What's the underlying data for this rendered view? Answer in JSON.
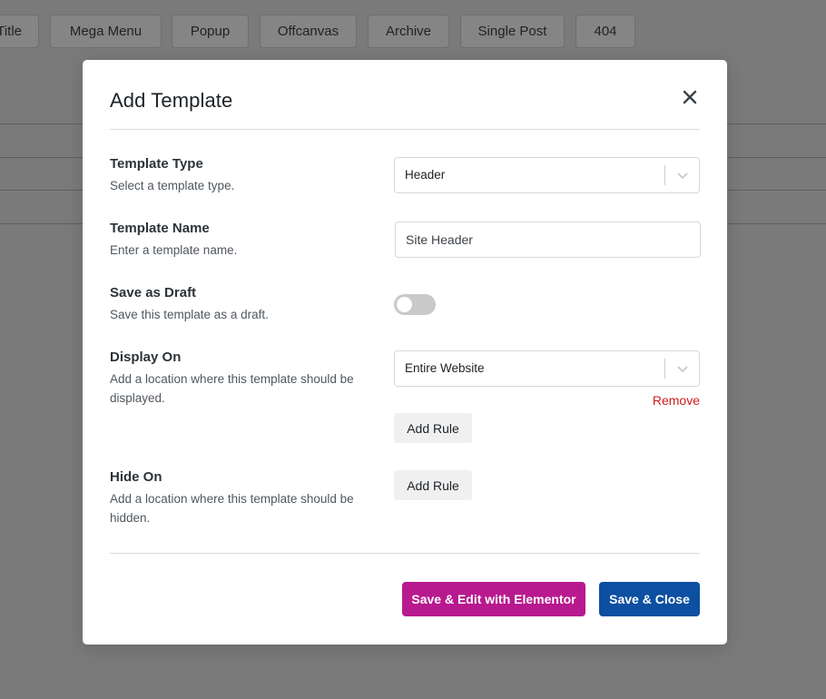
{
  "background": {
    "tabs": [
      "Title",
      "Mega Menu",
      "Popup",
      "Offcanvas",
      "Archive",
      "Single Post",
      "404"
    ]
  },
  "modal": {
    "title": "Add Template",
    "close_icon": "close-icon",
    "template_type": {
      "label": "Template Type",
      "description": "Select a template type.",
      "value": "Header"
    },
    "template_name": {
      "label": "Template Name",
      "description": "Enter a template name.",
      "value": "Site Header"
    },
    "save_as_draft": {
      "label": "Save as Draft",
      "description": "Save this template as a draft.",
      "checked": false
    },
    "display_on": {
      "label": "Display On",
      "description": "Add a location where this template should be displayed.",
      "value": "Entire Website",
      "remove_label": "Remove",
      "add_rule_label": "Add Rule"
    },
    "hide_on": {
      "label": "Hide On",
      "description": "Add a location where this template should be hidden.",
      "add_rule_label": "Add Rule"
    },
    "buttons": {
      "save_edit_elementor": "Save & Edit with Elementor",
      "save_close": "Save & Close"
    }
  },
  "colors": {
    "elementor": "#b8198f",
    "primary": "#0d4fa0",
    "danger": "#d01c1c"
  }
}
